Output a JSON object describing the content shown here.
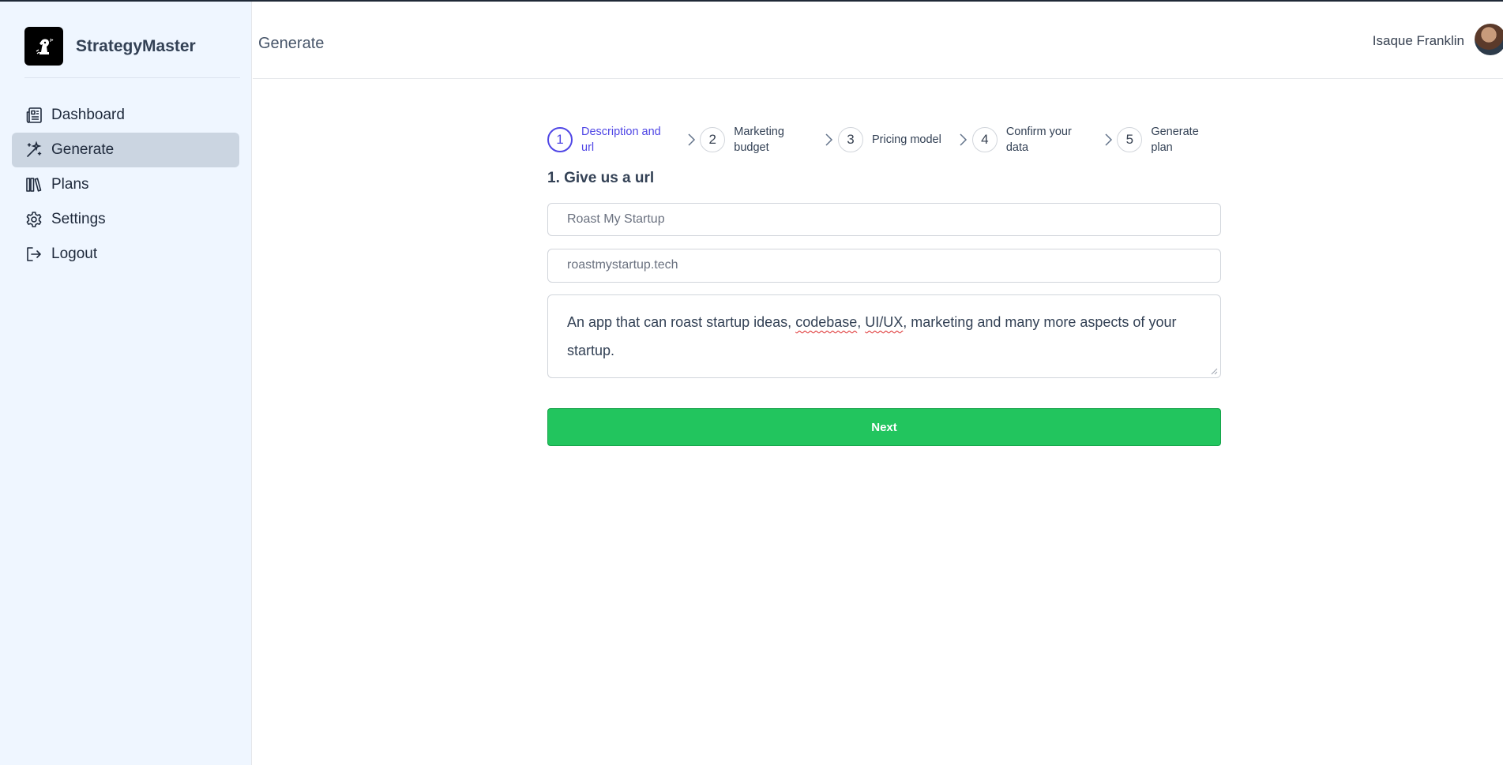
{
  "app": {
    "name": "StrategyMaster"
  },
  "sidebar": {
    "items": [
      {
        "label": "Dashboard",
        "icon": "newspaper-icon"
      },
      {
        "label": "Generate",
        "icon": "magic-wand-icon",
        "active": true
      },
      {
        "label": "Plans",
        "icon": "books-icon"
      },
      {
        "label": "Settings",
        "icon": "gear-icon"
      },
      {
        "label": "Logout",
        "icon": "logout-icon"
      }
    ]
  },
  "header": {
    "title": "Generate",
    "user_name": "Isaque Franklin"
  },
  "stepper": {
    "steps": [
      {
        "number": "1",
        "label": "Description and url",
        "active": true
      },
      {
        "number": "2",
        "label": "Marketing budget"
      },
      {
        "number": "3",
        "label": "Pricing model"
      },
      {
        "number": "4",
        "label": "Confirm your data"
      },
      {
        "number": "5",
        "label": "Generate plan"
      }
    ]
  },
  "form": {
    "section_title": "1. Give us a url",
    "name_value": "Roast My Startup",
    "url_value": "roastmystartup.tech",
    "description_value": "An app that can roast startup ideas, codebase, UI/UX, marketing and many more aspects of your startup.",
    "next_label": "Next"
  },
  "colors": {
    "accent": "#4f46e5",
    "primary_button": "#22c55e",
    "sidebar_bg": "#eff6ff",
    "active_nav": "#cbd5e1"
  }
}
